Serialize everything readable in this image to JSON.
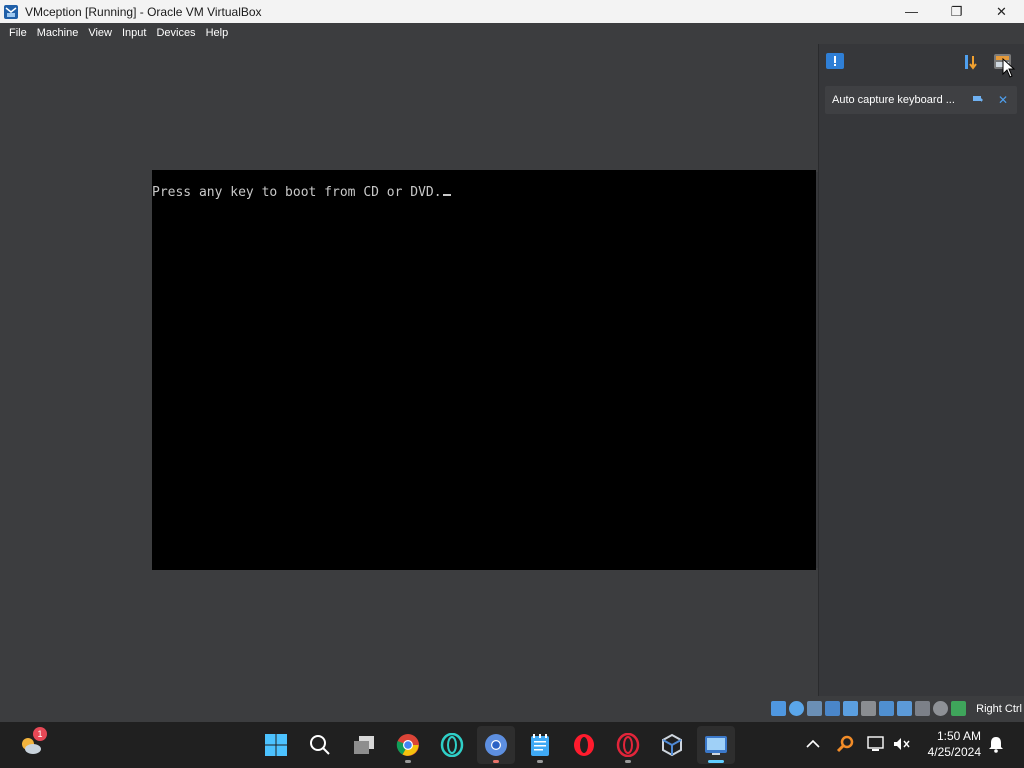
{
  "window": {
    "title": "VMception [Running] - Oracle VM VirtualBox",
    "minimize_glyph": "—",
    "maximize_glyph": "❐",
    "close_glyph": "✕"
  },
  "menu": {
    "items": [
      "File",
      "Machine",
      "View",
      "Input",
      "Devices",
      "Help"
    ]
  },
  "vm_screen": {
    "boot_message": "Press any key to boot from CD or DVD."
  },
  "notification_center": {
    "message": "Auto capture keyboard ...",
    "icons": [
      "message-center-icon",
      "sort-icon",
      "notifications-toggle-icon",
      "pin-icon",
      "close-icon"
    ]
  },
  "statusbar": {
    "host_key": "Right Ctrl",
    "indicator_icons": [
      "hard-disk-icon",
      "optical-drive-icon",
      "audio-icon",
      "network-icon",
      "usb-icon",
      "shared-folders-icon",
      "display-icon",
      "recording-icon",
      "cpu-icon",
      "mouse-integration-icon",
      "keyboard-icon"
    ]
  },
  "taskbar": {
    "weather_badge": "1",
    "time": "1:50 AM",
    "date": "4/25/2024",
    "apps": [
      "start-icon",
      "search-icon",
      "task-view-icon",
      "chrome-icon",
      "opera-gx-icon",
      "chrome-blue-icon",
      "notepad-icon",
      "opera-icon",
      "opera-red-icon",
      "virtualbox-icon",
      "vm-running-icon"
    ]
  },
  "colors": {
    "vm_background": "#3c3d3f",
    "panel_background": "#36373a",
    "taskbar": "#202020",
    "accent": "#60cdff"
  }
}
